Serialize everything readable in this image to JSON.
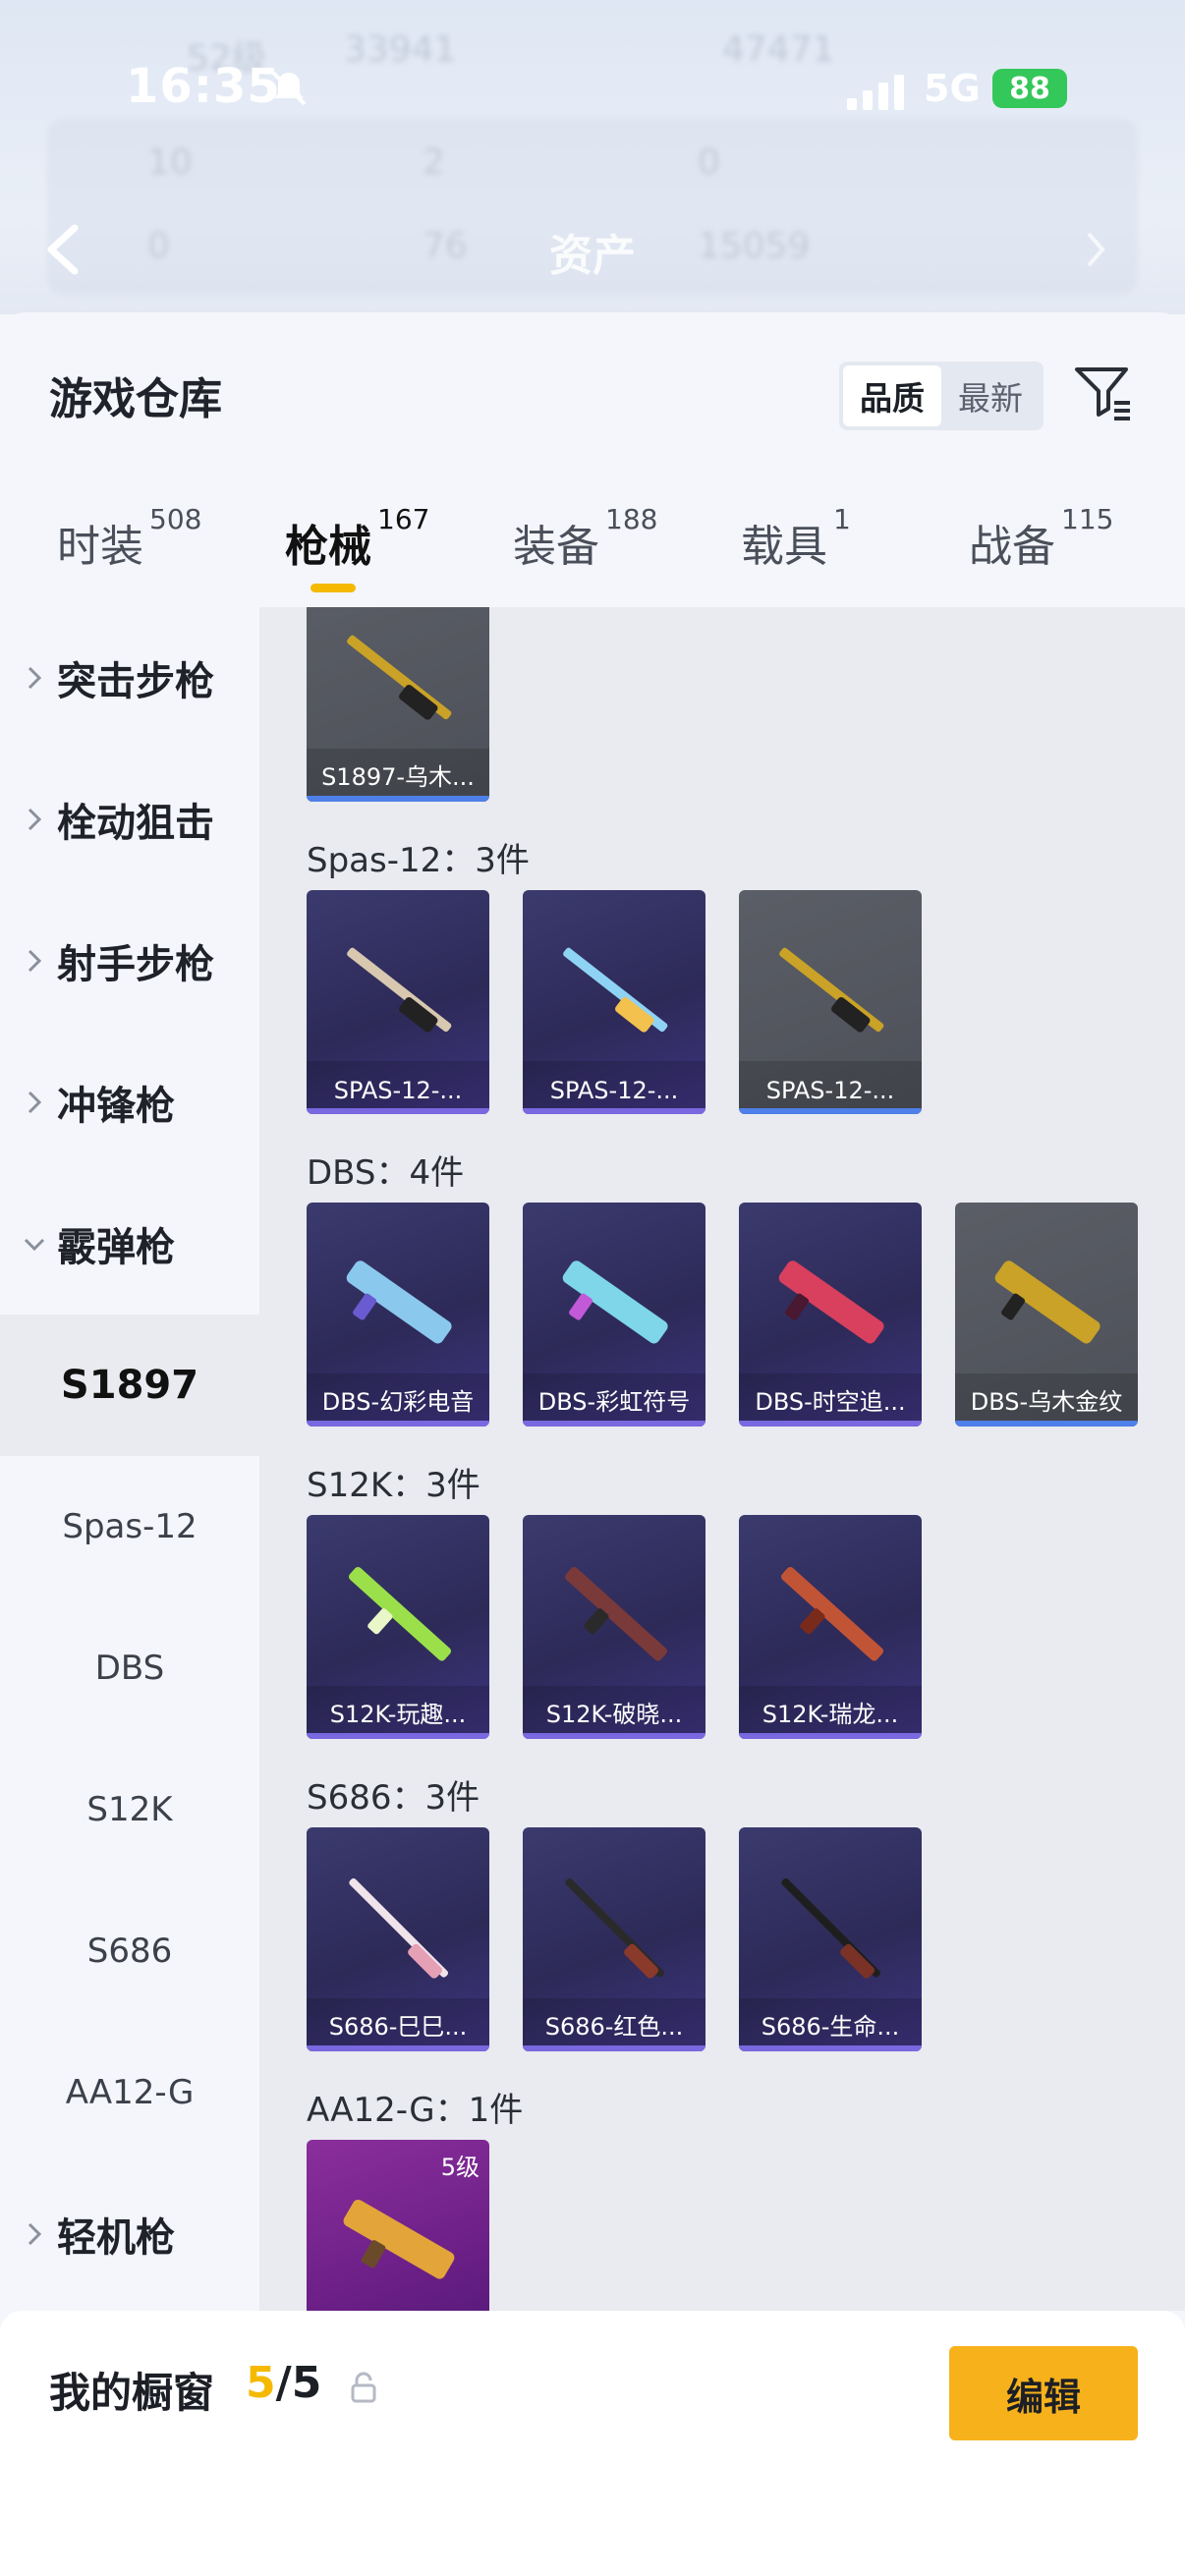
{
  "status_bar": {
    "time": "16:35",
    "network": "5G",
    "battery": "88"
  },
  "header_blur": {
    "player_level": "52级",
    "coins": "33941",
    "other_value": "47471",
    "stats": [
      "10",
      "2",
      "0",
      "0",
      "76",
      "15059"
    ],
    "title": "资产"
  },
  "panel": {
    "title": "游戏仓库",
    "sort": {
      "options": [
        "品质",
        "最新"
      ],
      "selected": "品质"
    }
  },
  "tabs": [
    {
      "label": "时装",
      "count": "508",
      "active": false
    },
    {
      "label": "枪械",
      "count": "167",
      "active": true
    },
    {
      "label": "装备",
      "count": "188",
      "active": false
    },
    {
      "label": "载具",
      "count": "1",
      "active": false
    },
    {
      "label": "战备",
      "count": "115",
      "active": false
    }
  ],
  "sidebar": {
    "items": [
      {
        "label": "突击步枪",
        "type": "category",
        "expanded": false
      },
      {
        "label": "栓动狙击",
        "type": "category",
        "expanded": false
      },
      {
        "label": "射手步枪",
        "type": "category",
        "expanded": false
      },
      {
        "label": "冲锋枪",
        "type": "category",
        "expanded": false
      },
      {
        "label": "霰弹枪",
        "type": "category",
        "expanded": true
      },
      {
        "label": "S1897",
        "type": "sub",
        "active": true
      },
      {
        "label": "Spas-12",
        "type": "sub",
        "active": false
      },
      {
        "label": "DBS",
        "type": "sub",
        "active": false
      },
      {
        "label": "S12K",
        "type": "sub",
        "active": false
      },
      {
        "label": "S686",
        "type": "sub",
        "active": false
      },
      {
        "label": "AA12-G",
        "type": "sub",
        "active": false
      },
      {
        "label": "轻机枪",
        "type": "category",
        "expanded": false
      }
    ]
  },
  "groups": [
    {
      "title": null,
      "items": [
        {
          "name": "S1897-乌木...",
          "style": "gray",
          "color": "#c9a227"
        }
      ]
    },
    {
      "title": "Spas-12：3件",
      "items": [
        {
          "name": "SPAS-12-...",
          "style": "purple",
          "color": "#d8c8b0"
        },
        {
          "name": "SPAS-12-...",
          "style": "purple",
          "color": "#8fd3f4"
        },
        {
          "name": "SPAS-12-...",
          "style": "gray",
          "color": "#c9a227"
        }
      ]
    },
    {
      "title": "DBS：4件",
      "items": [
        {
          "name": "DBS-幻彩电音",
          "style": "purple",
          "color": "#8bc8ee"
        },
        {
          "name": "DBS-彩虹符号",
          "style": "purple",
          "color": "#7ed6e8"
        },
        {
          "name": "DBS-时空追...",
          "style": "purple",
          "color": "#d8405e"
        },
        {
          "name": "DBS-乌木金纹",
          "style": "gray",
          "color": "#c9a227"
        }
      ]
    },
    {
      "title": "S12K：3件",
      "items": [
        {
          "name": "S12K-玩趣...",
          "style": "purple",
          "color": "#9be04a"
        },
        {
          "name": "S12K-破晓...",
          "style": "purple",
          "color": "#7a3a3a"
        },
        {
          "name": "S12K-瑞龙...",
          "style": "purple",
          "color": "#c25436"
        }
      ]
    },
    {
      "title": "S686：3件",
      "items": [
        {
          "name": "S686-巳巳...",
          "style": "purple",
          "color": "#f0e4ea"
        },
        {
          "name": "S686-红色...",
          "style": "purple",
          "color": "#8a3a2a"
        },
        {
          "name": "S686-生命...",
          "style": "purple",
          "color": "#7a3226"
        }
      ]
    },
    {
      "title": "AA12-G：1件",
      "items": [
        {
          "name": "",
          "style": "magenta",
          "level": "5级",
          "color": "#e3a43a"
        }
      ]
    }
  ],
  "bottom": {
    "label": "我的橱窗",
    "current": "5",
    "slash": "/",
    "total": "5",
    "edit_label": "编辑"
  },
  "colors": {
    "accent": "#f5b900",
    "fab": "#f7b21b"
  }
}
